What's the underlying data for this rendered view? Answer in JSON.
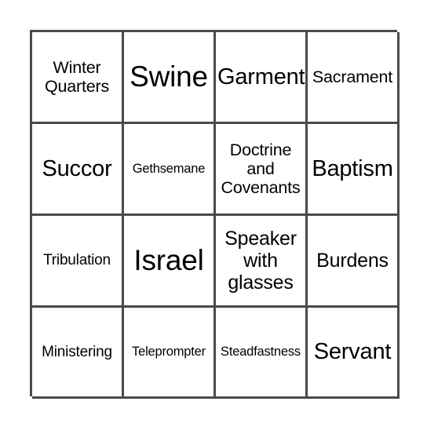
{
  "card": {
    "type": "bingo-card",
    "columns": 4,
    "rows": 4,
    "border_color": "#4a4a4a",
    "background_color": "#ffffff",
    "text_color": "#000000",
    "cells": [
      {
        "id": "r1c1",
        "row": 1,
        "col": 1,
        "text": "Winter Quarters",
        "size": "m",
        "marked": false
      },
      {
        "id": "r1c2",
        "row": 1,
        "col": 2,
        "text": "Swine",
        "size": "xxl",
        "marked": false
      },
      {
        "id": "r1c3",
        "row": 1,
        "col": 3,
        "text": "Garment",
        "size": "xl",
        "marked": false
      },
      {
        "id": "r1c4",
        "row": 1,
        "col": 4,
        "text": "Sacrament",
        "size": "m",
        "marked": false
      },
      {
        "id": "r2c1",
        "row": 2,
        "col": 1,
        "text": "Succor",
        "size": "xl",
        "marked": false
      },
      {
        "id": "r2c2",
        "row": 2,
        "col": 2,
        "text": "Gethsemane",
        "size": "xs",
        "marked": false
      },
      {
        "id": "r2c3",
        "row": 2,
        "col": 3,
        "text": "Doctrine and Covenants",
        "size": "m",
        "marked": false
      },
      {
        "id": "r2c4",
        "row": 2,
        "col": 4,
        "text": "Baptism",
        "size": "xl",
        "marked": false
      },
      {
        "id": "r3c1",
        "row": 3,
        "col": 1,
        "text": "Tribulation",
        "size": "s",
        "marked": false
      },
      {
        "id": "r3c2",
        "row": 3,
        "col": 2,
        "text": "Israel",
        "size": "xxl",
        "marked": false
      },
      {
        "id": "r3c3",
        "row": 3,
        "col": 3,
        "text": "Speaker with glasses",
        "size": "l",
        "marked": false
      },
      {
        "id": "r3c4",
        "row": 3,
        "col": 4,
        "text": "Burdens",
        "size": "l",
        "marked": false
      },
      {
        "id": "r4c1",
        "row": 4,
        "col": 1,
        "text": "Ministering",
        "size": "s",
        "marked": false
      },
      {
        "id": "r4c2",
        "row": 4,
        "col": 2,
        "text": "Teleprompter",
        "size": "xs",
        "marked": false
      },
      {
        "id": "r4c3",
        "row": 4,
        "col": 3,
        "text": "Steadfastness",
        "size": "xs",
        "marked": false
      },
      {
        "id": "r4c4",
        "row": 4,
        "col": 4,
        "text": "Servant",
        "size": "xl",
        "marked": false
      }
    ]
  }
}
